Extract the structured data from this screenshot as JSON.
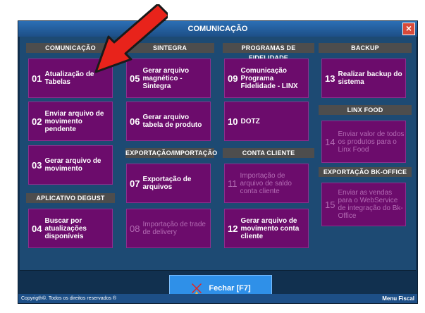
{
  "window": {
    "title": "COMUNICAÇÃO",
    "close_label": "×"
  },
  "headers": {
    "comunicacao": "COMUNICAÇÃO",
    "sintegra": "SINTEGRA",
    "fidelidade": "PROGRAMAS DE FIDELIDADE",
    "backup": "BACKUP",
    "linx_food": "LINX FOOD",
    "exportacao": "EXPORTAÇÃO/IMPORTAÇÃO",
    "conta_cliente": "CONTA CLIENTE",
    "bk_office": "EXPORTAÇÃO BK-OFFICE",
    "degust": "APLICATIVO DEGUST"
  },
  "tiles": {
    "t01": {
      "num": "01",
      "label": "Atualização de Tabelas"
    },
    "t02": {
      "num": "02",
      "label": "Enviar arquivo de movimento pendente"
    },
    "t03": {
      "num": "03",
      "label": "Gerar arquivo de movimento"
    },
    "t04": {
      "num": "04",
      "label": "Buscar por atualizações disponíveis"
    },
    "t05": {
      "num": "05",
      "label": "Gerar arquivo magnético - Sintegra"
    },
    "t06": {
      "num": "06",
      "label": "Gerar arquivo tabela de produto"
    },
    "t07": {
      "num": "07",
      "label": "Exportação de arquivos"
    },
    "t08": {
      "num": "08",
      "label": "Importação de trade de delivery"
    },
    "t09": {
      "num": "09",
      "label": "Comunicação Programa Fidelidade - LINX"
    },
    "t10": {
      "num": "10",
      "label": "DOTZ"
    },
    "t11": {
      "num": "11",
      "label": "Importação de arquivo de saldo conta cliente"
    },
    "t12": {
      "num": "12",
      "label": "Gerar arquivo de movimento conta cliente"
    },
    "t13": {
      "num": "13",
      "label": "Realizar backup do sistema"
    },
    "t14": {
      "num": "14",
      "label": "Enviar valor de todos os produtos para o Linx Food"
    },
    "t15": {
      "num": "15",
      "label": "Enviar as vendas para o WebService de integração do Bk-Office"
    }
  },
  "footer": {
    "close_button_label": "Fechar [F7]"
  },
  "statusbar": {
    "copyright": "Copyrigth©. Todos os direitos reservados ®",
    "menu_fiscal": "Menu Fiscal"
  },
  "colors": {
    "tile": "#6c0c6c",
    "header": "#4d4d4d",
    "panel": "#1d4a73",
    "close_button": "#2f90e8",
    "arrow": "#e8231b"
  }
}
